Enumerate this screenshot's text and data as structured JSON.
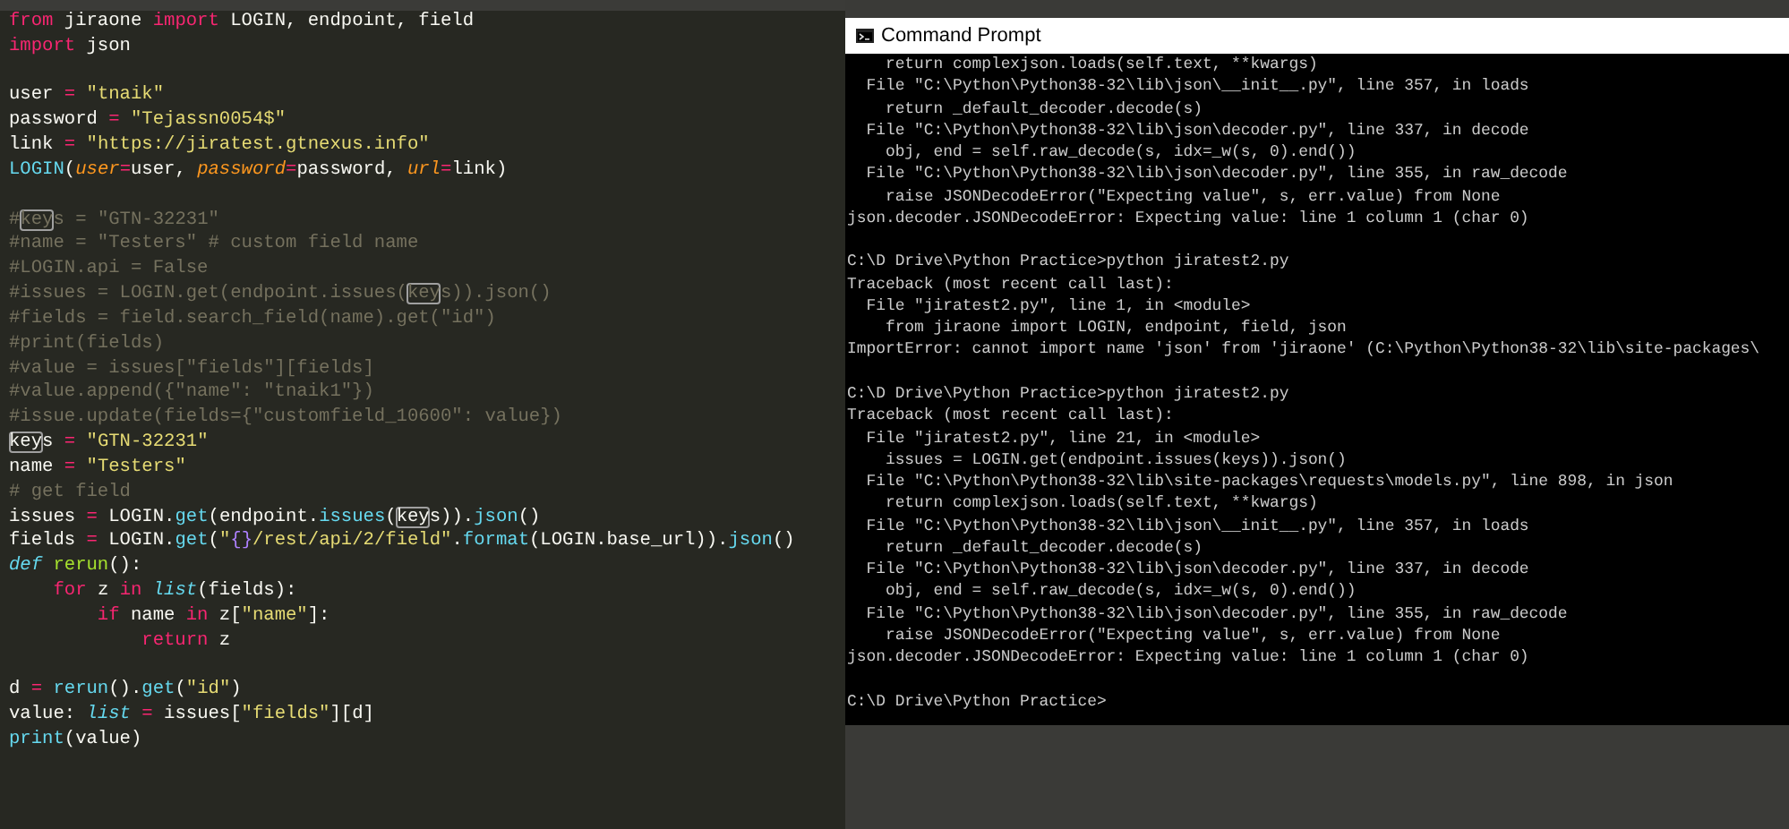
{
  "editor": {
    "lines": [
      {
        "kind": "code",
        "tokens": [
          {
            "text": "from",
            "kind": "keyword"
          },
          {
            "text": " jiraone ",
            "kind": "plain"
          },
          {
            "text": "import",
            "kind": "keyword"
          },
          {
            "text": " LOGIN, endpoint, field",
            "kind": "plain"
          }
        ]
      },
      {
        "kind": "code",
        "tokens": [
          {
            "text": "import",
            "kind": "keyword"
          },
          {
            "text": " json",
            "kind": "plain"
          }
        ]
      },
      {
        "kind": "blank"
      },
      {
        "kind": "code",
        "tokens": [
          {
            "text": "user ",
            "kind": "plain"
          },
          {
            "text": "=",
            "kind": "operator"
          },
          {
            "text": " \"tnaik\"",
            "kind": "string"
          }
        ]
      },
      {
        "kind": "code",
        "tokens": [
          {
            "text": "password ",
            "kind": "plain"
          },
          {
            "text": "=",
            "kind": "operator"
          },
          {
            "text": " \"Tejassn0054$\"",
            "kind": "string"
          }
        ]
      },
      {
        "kind": "code",
        "tokens": [
          {
            "text": "link ",
            "kind": "plain"
          },
          {
            "text": "=",
            "kind": "operator"
          },
          {
            "text": " \"https://jiratest.gtnexus.info\"",
            "kind": "string"
          }
        ]
      },
      {
        "kind": "code",
        "tokens": [
          {
            "text": "LOGIN",
            "kind": "function"
          },
          {
            "text": "(",
            "kind": "plain"
          },
          {
            "text": "user",
            "kind": "parameter"
          },
          {
            "text": "=",
            "kind": "operator"
          },
          {
            "text": "user, ",
            "kind": "plain"
          },
          {
            "text": "password",
            "kind": "parameter"
          },
          {
            "text": "=",
            "kind": "operator"
          },
          {
            "text": "password, ",
            "kind": "plain"
          },
          {
            "text": "url",
            "kind": "parameter"
          },
          {
            "text": "=",
            "kind": "operator"
          },
          {
            "text": "link)",
            "kind": "plain"
          }
        ]
      },
      {
        "kind": "blank"
      },
      {
        "kind": "code",
        "tokens": [
          {
            "text": "#",
            "kind": "comment"
          },
          {
            "text": "key",
            "kind": "comment-match"
          },
          {
            "text": "s = \"GTN-32231\"",
            "kind": "comment"
          }
        ]
      },
      {
        "kind": "code",
        "tokens": [
          {
            "text": "#name = \"Testers\" # custom field name",
            "kind": "comment"
          }
        ]
      },
      {
        "kind": "code",
        "tokens": [
          {
            "text": "#LOGIN.api = False",
            "kind": "comment"
          }
        ]
      },
      {
        "kind": "code",
        "tokens": [
          {
            "text": "#issues = LOGIN.get(endpoint.issues(",
            "kind": "comment"
          },
          {
            "text": "key",
            "kind": "comment-match"
          },
          {
            "text": "s)).json()",
            "kind": "comment"
          }
        ]
      },
      {
        "kind": "code",
        "tokens": [
          {
            "text": "#fields = field.search_field(name).get(\"id\")",
            "kind": "comment"
          }
        ]
      },
      {
        "kind": "code",
        "tokens": [
          {
            "text": "#print(fields)",
            "kind": "comment"
          }
        ]
      },
      {
        "kind": "code",
        "tokens": [
          {
            "text": "#value = issues[\"fields\"][fields]",
            "kind": "comment"
          }
        ]
      },
      {
        "kind": "code",
        "tokens": [
          {
            "text": "#value.append({\"name\": \"tnaik1\"})",
            "kind": "comment"
          }
        ]
      },
      {
        "kind": "code",
        "tokens": [
          {
            "text": "#issue.update(fields={\"customfield_10600\": value})",
            "kind": "comment"
          }
        ]
      },
      {
        "kind": "code",
        "tokens": [
          {
            "text": "key",
            "kind": "match"
          },
          {
            "text": "s ",
            "kind": "plain"
          },
          {
            "text": "=",
            "kind": "operator"
          },
          {
            "text": " \"GTN-32231\"",
            "kind": "string"
          }
        ]
      },
      {
        "kind": "code",
        "tokens": [
          {
            "text": "name ",
            "kind": "plain"
          },
          {
            "text": "=",
            "kind": "operator"
          },
          {
            "text": " \"Testers\"",
            "kind": "string"
          }
        ]
      },
      {
        "kind": "code",
        "tokens": [
          {
            "text": "# get field",
            "kind": "comment"
          }
        ]
      },
      {
        "kind": "code",
        "tokens": [
          {
            "text": "issues ",
            "kind": "plain"
          },
          {
            "text": "=",
            "kind": "operator"
          },
          {
            "text": " LOGIN.",
            "kind": "plain"
          },
          {
            "text": "get",
            "kind": "function"
          },
          {
            "text": "(endpoint.",
            "kind": "plain"
          },
          {
            "text": "issues",
            "kind": "function"
          },
          {
            "text": "(",
            "kind": "plain"
          },
          {
            "text": "key",
            "kind": "match"
          },
          {
            "text": "s)).",
            "kind": "plain"
          },
          {
            "text": "json",
            "kind": "function"
          },
          {
            "text": "()",
            "kind": "plain"
          }
        ]
      },
      {
        "kind": "code",
        "tokens": [
          {
            "text": "fields ",
            "kind": "plain"
          },
          {
            "text": "=",
            "kind": "operator"
          },
          {
            "text": " LOGIN.",
            "kind": "plain"
          },
          {
            "text": "get",
            "kind": "function"
          },
          {
            "text": "(",
            "kind": "plain"
          },
          {
            "text": "\"",
            "kind": "string"
          },
          {
            "text": "{}",
            "kind": "constant"
          },
          {
            "text": "/rest/api/2/field\"",
            "kind": "string"
          },
          {
            "text": ".",
            "kind": "plain"
          },
          {
            "text": "format",
            "kind": "function"
          },
          {
            "text": "(LOGIN.base_url)).",
            "kind": "plain"
          },
          {
            "text": "json",
            "kind": "function"
          },
          {
            "text": "()",
            "kind": "plain"
          }
        ]
      },
      {
        "kind": "code",
        "tokens": [
          {
            "text": "def ",
            "kind": "storage"
          },
          {
            "text": "rerun",
            "kind": "definition"
          },
          {
            "text": "():",
            "kind": "plain"
          }
        ]
      },
      {
        "kind": "code",
        "tokens": [
          {
            "text": "    for",
            "kind": "keyword"
          },
          {
            "text": " z ",
            "kind": "plain"
          },
          {
            "text": "in ",
            "kind": "keyword"
          },
          {
            "text": "list",
            "kind": "storage"
          },
          {
            "text": "(fields):",
            "kind": "plain"
          }
        ]
      },
      {
        "kind": "code",
        "tokens": [
          {
            "text": "        if",
            "kind": "keyword"
          },
          {
            "text": " name ",
            "kind": "plain"
          },
          {
            "text": "in",
            "kind": "keyword"
          },
          {
            "text": " z[",
            "kind": "plain"
          },
          {
            "text": "\"name\"",
            "kind": "string"
          },
          {
            "text": "]:",
            "kind": "plain"
          }
        ]
      },
      {
        "kind": "code",
        "tokens": [
          {
            "text": "            return",
            "kind": "keyword"
          },
          {
            "text": " z",
            "kind": "plain"
          }
        ]
      },
      {
        "kind": "blank"
      },
      {
        "kind": "code",
        "tokens": [
          {
            "text": "d ",
            "kind": "plain"
          },
          {
            "text": "= ",
            "kind": "operator"
          },
          {
            "text": "rerun",
            "kind": "function"
          },
          {
            "text": "().",
            "kind": "plain"
          },
          {
            "text": "get",
            "kind": "function"
          },
          {
            "text": "(",
            "kind": "plain"
          },
          {
            "text": "\"id\"",
            "kind": "string"
          },
          {
            "text": ")",
            "kind": "plain"
          }
        ]
      },
      {
        "kind": "code",
        "tokens": [
          {
            "text": "value: ",
            "kind": "plain"
          },
          {
            "text": "list ",
            "kind": "storage"
          },
          {
            "text": "=",
            "kind": "operator"
          },
          {
            "text": " issues[",
            "kind": "plain"
          },
          {
            "text": "\"fields\"",
            "kind": "string"
          },
          {
            "text": "][d]",
            "kind": "plain"
          }
        ]
      },
      {
        "kind": "code",
        "tokens": [
          {
            "text": "print",
            "kind": "function"
          },
          {
            "text": "(value)",
            "kind": "plain"
          }
        ]
      }
    ]
  },
  "console": {
    "title": "Command Prompt",
    "lines": [
      {
        "kind": "text",
        "text": "    return complexjson.loads(self.text, **kwargs)"
      },
      {
        "kind": "text",
        "text": "  File \"C:\\Python\\Python38-32\\lib\\json\\__init__.py\", line 357, in loads"
      },
      {
        "kind": "text",
        "text": "    return _default_decoder.decode(s)"
      },
      {
        "kind": "text",
        "text": "  File \"C:\\Python\\Python38-32\\lib\\json\\decoder.py\", line 337, in decode"
      },
      {
        "kind": "text",
        "text": "    obj, end = self.raw_decode(s, idx=_w(s, 0).end())"
      },
      {
        "kind": "text",
        "text": "  File \"C:\\Python\\Python38-32\\lib\\json\\decoder.py\", line 355, in raw_decode"
      },
      {
        "kind": "text",
        "text": "    raise JSONDecodeError(\"Expecting value\", s, err.value) from None"
      },
      {
        "kind": "text",
        "text": "json.decoder.JSONDecodeError: Expecting value: line 1 column 1 (char 0)"
      },
      {
        "kind": "blank"
      },
      {
        "kind": "text",
        "text": "C:\\D Drive\\Python Practice>python jiratest2.py"
      },
      {
        "kind": "text",
        "text": "Traceback (most recent call last):"
      },
      {
        "kind": "text",
        "text": "  File \"jiratest2.py\", line 1, in <module>"
      },
      {
        "kind": "text",
        "text": "    from jiraone import LOGIN, endpoint, field, json"
      },
      {
        "kind": "text",
        "text": "ImportError: cannot import name 'json' from 'jiraone' (C:\\Python\\Python38-32\\lib\\site-packages\\"
      },
      {
        "kind": "blank"
      },
      {
        "kind": "text",
        "text": "C:\\D Drive\\Python Practice>python jiratest2.py"
      },
      {
        "kind": "text",
        "text": "Traceback (most recent call last):"
      },
      {
        "kind": "text",
        "text": "  File \"jiratest2.py\", line 21, in <module>"
      },
      {
        "kind": "text",
        "text": "    issues = LOGIN.get(endpoint.issues(keys)).json()"
      },
      {
        "kind": "text",
        "text": "  File \"C:\\Python\\Python38-32\\lib\\site-packages\\requests\\models.py\", line 898, in json"
      },
      {
        "kind": "text",
        "text": "    return complexjson.loads(self.text, **kwargs)"
      },
      {
        "kind": "text",
        "text": "  File \"C:\\Python\\Python38-32\\lib\\json\\__init__.py\", line 357, in loads"
      },
      {
        "kind": "text",
        "text": "    return _default_decoder.decode(s)"
      },
      {
        "kind": "text",
        "text": "  File \"C:\\Python\\Python38-32\\lib\\json\\decoder.py\", line 337, in decode"
      },
      {
        "kind": "text",
        "text": "    obj, end = self.raw_decode(s, idx=_w(s, 0).end())"
      },
      {
        "kind": "text",
        "text": "  File \"C:\\Python\\Python38-32\\lib\\json\\decoder.py\", line 355, in raw_decode"
      },
      {
        "kind": "text",
        "text": "    raise JSONDecodeError(\"Expecting value\", s, err.value) from None"
      },
      {
        "kind": "text",
        "text": "json.decoder.JSONDecodeError: Expecting value: line 1 column 1 (char 0)"
      },
      {
        "kind": "blank"
      },
      {
        "kind": "text",
        "text": "C:\\D Drive\\Python Practice>"
      }
    ]
  }
}
